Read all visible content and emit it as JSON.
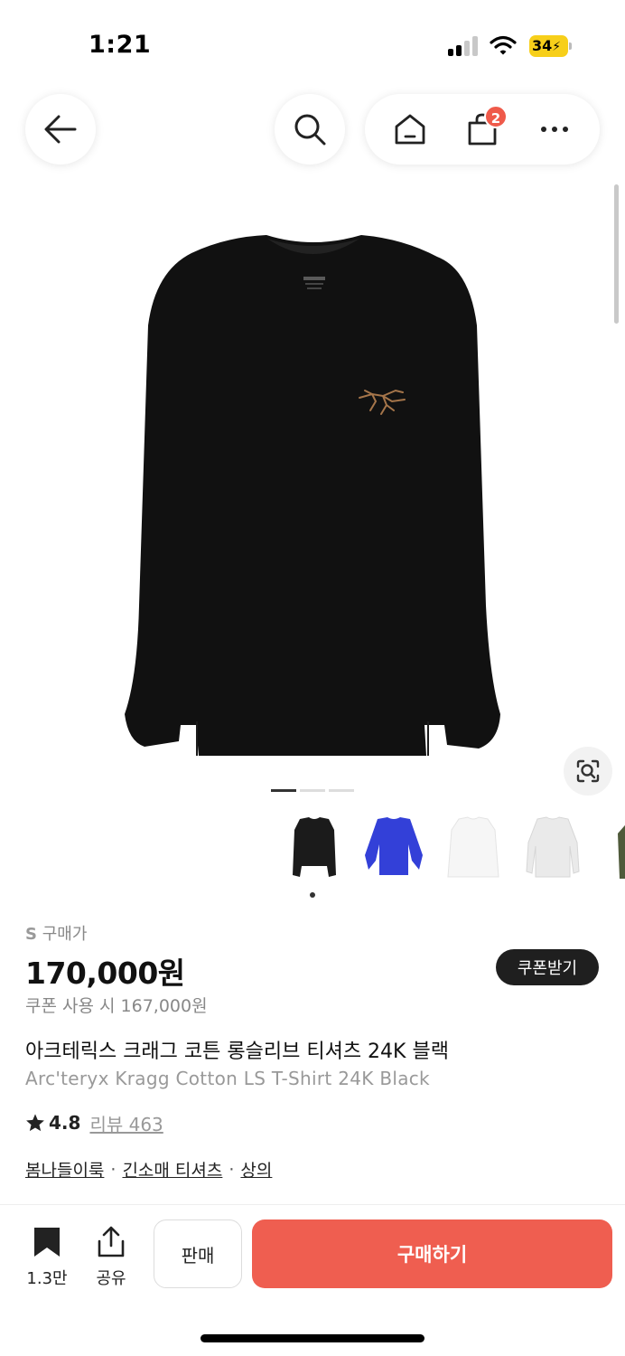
{
  "status": {
    "time": "1:21",
    "battery": "34"
  },
  "nav": {
    "cart_count": "2"
  },
  "gallery": {
    "page_count": 3,
    "active_page": 1,
    "selected_thumb": 1
  },
  "thumbnails": [
    {
      "name": "black",
      "color": "#1b1b1b"
    },
    {
      "name": "blue",
      "color": "#3340d8"
    },
    {
      "name": "white",
      "color": "#f6f6f6"
    },
    {
      "name": "light-gray",
      "color": "#eaeaea"
    },
    {
      "name": "olive",
      "color": "#4f5a3a"
    }
  ],
  "product": {
    "size": "S",
    "price_label": "구매가",
    "price": "170,000원",
    "coupon_price": "쿠폰 사용 시 167,000원",
    "coupon_button": "쿠폰받기",
    "title_ko": "아크테릭스 크래그 코튼 롱슬리브 티셔츠 24K 블랙",
    "title_en": "Arc'teryx Kragg Cotton LS T-Shirt 24K Black",
    "rating": "4.8",
    "review_label": "리뷰 463",
    "categories": [
      "봄나들이룩",
      "긴소매 티셔츠",
      "상의"
    ],
    "category_separator": "·"
  },
  "bottom_bar": {
    "save_count": "1.3만",
    "share_label": "공유",
    "sell_label": "판매",
    "buy_label": "구매하기"
  },
  "colors": {
    "accent": "#ef5e50",
    "badge": "#ef5a4a",
    "dark": "#1f1f1f",
    "shirt": "#111111",
    "logo": "#a5754a"
  }
}
